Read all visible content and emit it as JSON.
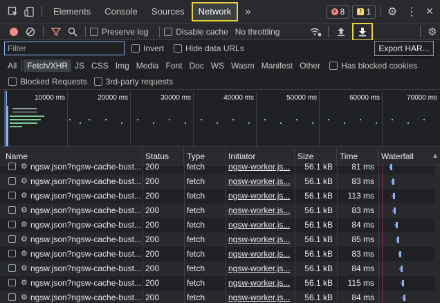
{
  "tabs": {
    "elements": "Elements",
    "console": "Console",
    "sources": "Sources",
    "network": "Network",
    "more": "»"
  },
  "badges": {
    "errors": "8",
    "warnings": "1",
    "error_icon": "×",
    "warning_icon": "!"
  },
  "icons": {
    "inspect": "inspect-element-icon",
    "device": "device-toolbar-icon",
    "settings": "gear-icon",
    "menu": "more-vertical-icon",
    "close": "close-icon"
  },
  "glyphs": {
    "settings": "⚙",
    "menu": "⋮",
    "close": "✕"
  },
  "toolbar": {
    "preserve_log": "Preserve log",
    "disable_cache": "Disable cache",
    "throttling": "No throttling",
    "export_tooltip": "Export HAR..."
  },
  "filter": {
    "placeholder": "Filter",
    "value": "",
    "invert": "Invert",
    "hide_data_urls": "Hide data URLs"
  },
  "type_filters": [
    "All",
    "Fetch/XHR",
    "JS",
    "CSS",
    "Img",
    "Media",
    "Font",
    "Doc",
    "WS",
    "Wasm",
    "Manifest",
    "Other"
  ],
  "type_filter_active": "Fetch/XHR",
  "blocked_cookies": "Has blocked cookies",
  "blocked_requests": "Blocked Requests",
  "third_party": "3rd-party requests",
  "overview_ticks": [
    "10000 ms",
    "20000 ms",
    "30000 ms",
    "40000 ms",
    "50000 ms",
    "60000 ms",
    "70000 ms"
  ],
  "columns": {
    "name": "Name",
    "status": "Status",
    "type": "Type",
    "initiator": "Initiator",
    "size": "Size",
    "time": "Time",
    "waterfall": "Waterfall"
  },
  "rows": [
    {
      "name": "ngsw.json?ngsw-cache-bust...",
      "status": "200",
      "type": "fetch",
      "initiator": "ngsw-worker.js...",
      "size": "56.1 kB",
      "time": "81 ms"
    },
    {
      "name": "ngsw.json?ngsw-cache-bust...",
      "status": "200",
      "type": "fetch",
      "initiator": "ngsw-worker.js...",
      "size": "56.1 kB",
      "time": "83 ms"
    },
    {
      "name": "ngsw.json?ngsw-cache-bust...",
      "status": "200",
      "type": "fetch",
      "initiator": "ngsw-worker.js...",
      "size": "56.1 kB",
      "time": "113 ms"
    },
    {
      "name": "ngsw.json?ngsw-cache-bust...",
      "status": "200",
      "type": "fetch",
      "initiator": "ngsw-worker.js...",
      "size": "56.1 kB",
      "time": "83 ms"
    },
    {
      "name": "ngsw.json?ngsw-cache-bust...",
      "status": "200",
      "type": "fetch",
      "initiator": "ngsw-worker.js...",
      "size": "56.1 kB",
      "time": "84 ms"
    },
    {
      "name": "ngsw.json?ngsw-cache-bust...",
      "status": "200",
      "type": "fetch",
      "initiator": "ngsw-worker.js...",
      "size": "56.1 kB",
      "time": "85 ms"
    },
    {
      "name": "ngsw.json?ngsw-cache-bust...",
      "status": "200",
      "type": "fetch",
      "initiator": "ngsw-worker.js...",
      "size": "56.1 kB",
      "time": "83 ms"
    },
    {
      "name": "ngsw.json?ngsw-cache-bust...",
      "status": "200",
      "type": "fetch",
      "initiator": "ngsw-worker.js...",
      "size": "56.1 kB",
      "time": "84 ms"
    },
    {
      "name": "ngsw.json?ngsw-cache-bust...",
      "status": "200",
      "type": "fetch",
      "initiator": "ngsw-worker.js...",
      "size": "56.1 kB",
      "time": "115 ms"
    },
    {
      "name": "ngsw.json?ngsw-cache-bust...",
      "status": "200",
      "type": "fetch",
      "initiator": "ngsw-worker.js...",
      "size": "56.1 kB",
      "time": "84 ms"
    }
  ],
  "colors": {
    "highlight": "#e8d43a",
    "record": "#f28b82",
    "filter_icon": "#f28b82",
    "waterfall_bar": "#8ab4f8",
    "accent": "#8ab4f8"
  }
}
